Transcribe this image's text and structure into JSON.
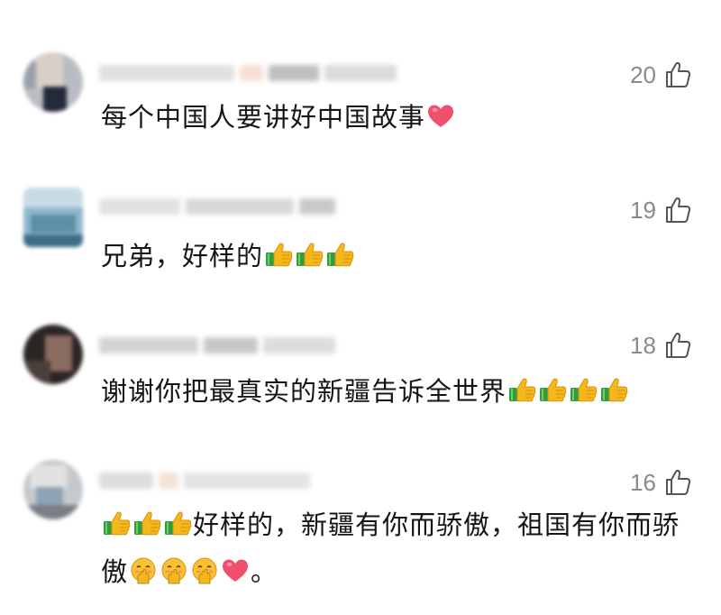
{
  "comments": [
    {
      "likes": "20",
      "text": "每个中国人要讲好中国故事",
      "emojis_after": [
        "heart-icon"
      ]
    },
    {
      "likes": "19",
      "text": "兄弟，好样的",
      "emojis_after": [
        "thumbs-up-icon",
        "thumbs-up-icon",
        "thumbs-up-icon"
      ]
    },
    {
      "likes": "18",
      "text": "谢谢你把最真实的新疆告诉全世界",
      "emojis_after": [
        "thumbs-up-icon",
        "thumbs-up-icon",
        "thumbs-up-icon",
        "thumbs-up-icon"
      ]
    },
    {
      "likes": "16",
      "emojis_before": [
        "thumbs-up-icon",
        "thumbs-up-icon",
        "thumbs-up-icon"
      ],
      "text": "好样的，新疆有你而骄傲，祖国有你而骄傲",
      "emojis_after": [
        "shushing-face-icon",
        "shushing-face-icon",
        "shushing-face-icon",
        "heart-icon"
      ],
      "suffix": "。"
    }
  ],
  "colors": {
    "likes_text": "#8a8a8a",
    "comment_text": "#151515",
    "heart": "#f0506e",
    "thumb": "#f4b81c",
    "cuff": "#2e9e3e"
  }
}
